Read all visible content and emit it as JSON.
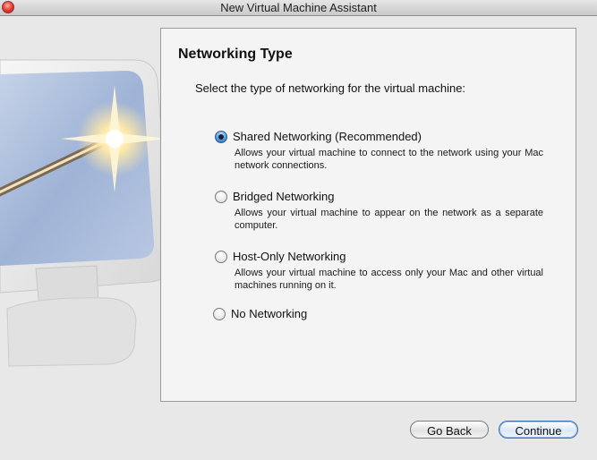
{
  "window": {
    "title": "New Virtual Machine Assistant"
  },
  "icons": {
    "close": "close-icon",
    "artwork": "monitor-with-magic-wand-illustration"
  },
  "panel": {
    "heading": "Networking Type",
    "prompt": "Select the type of networking for the virtual machine:",
    "options": [
      {
        "label": "Shared Networking (Recommended)",
        "description": "Allows your virtual machine to connect to the network using your Mac network connections.",
        "selected": true
      },
      {
        "label": "Bridged Networking",
        "description": "Allows your virtual machine to appear on the network as a separate computer.",
        "selected": false
      },
      {
        "label": "Host-Only Networking",
        "description": "Allows your virtual machine to access only your Mac and other virtual machines running on it.",
        "selected": false
      },
      {
        "label": "No Networking",
        "description": "",
        "selected": false
      }
    ]
  },
  "buttons": {
    "back": "Go Back",
    "continue": "Continue"
  },
  "colors": {
    "selected_radio": "#2a62b0",
    "default_button_border": "#3f6ea7"
  }
}
